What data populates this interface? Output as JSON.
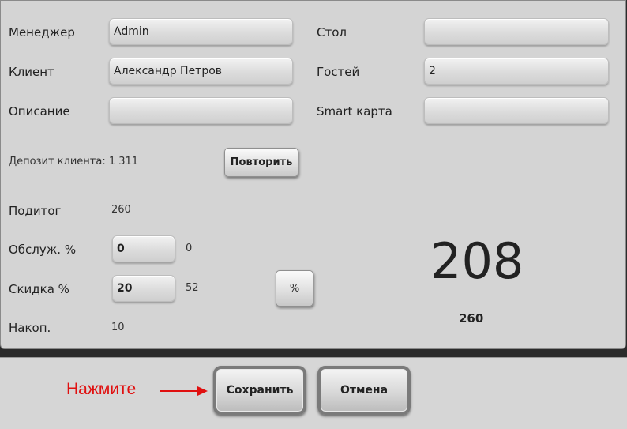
{
  "form": {
    "manager_label": "Менеджер",
    "manager_value": "Admin",
    "client_label": "Клиент",
    "client_value": "Александр Петров",
    "description_label": "Описание",
    "description_value": "",
    "table_label": "Стол",
    "table_value": "",
    "guests_label": "Гостей",
    "guests_value": "2",
    "smart_card_label": "Smart карта",
    "smart_card_value": ""
  },
  "deposit": {
    "text": "Депозит клиента: 1 311",
    "retry_label": "Повторить"
  },
  "totals": {
    "subtotal_label": "Подитог",
    "subtotal_value": "260",
    "service_label": "Обслуж. %",
    "service_input": "0",
    "service_amount": "0",
    "discount_label": "Скидка %",
    "discount_input": "20",
    "discount_amount": "52",
    "accum_label": "Накоп.",
    "accum_value": "10",
    "percent_button_label": "%",
    "grand_total": "208",
    "before_discount": "260"
  },
  "footer": {
    "hint": "Нажмите",
    "save_label": "Сохранить",
    "cancel_label": "Отмена"
  },
  "colors": {
    "hint": "#e01010",
    "panel": "#d4d4d4"
  }
}
